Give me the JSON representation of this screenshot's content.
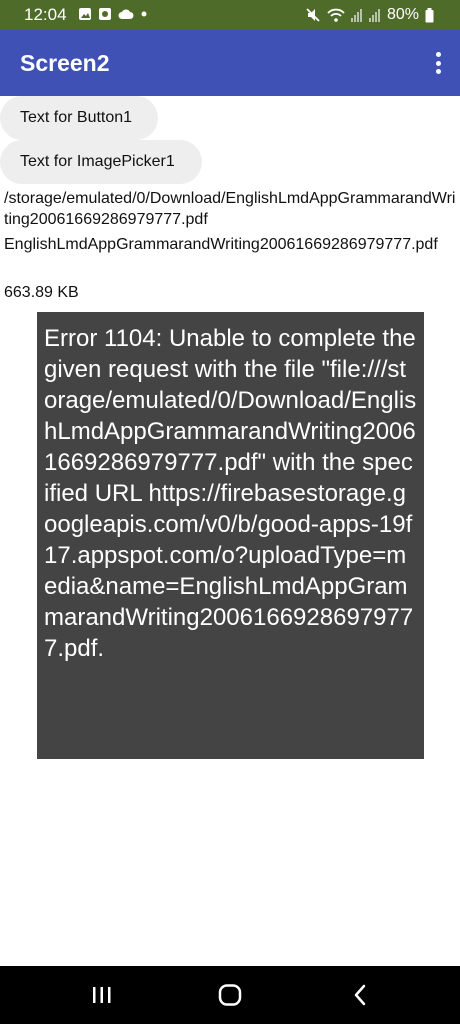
{
  "status_bar": {
    "time": "12:04",
    "left_icons": [
      "image-icon",
      "photo-icon",
      "cloud-icon",
      "dot-icon"
    ],
    "right_icons": [
      "mute-icon",
      "wifi-icon",
      "signal-icon",
      "signal-icon",
      "battery-icon"
    ],
    "battery": "80%"
  },
  "app_bar": {
    "title": "Screen2",
    "background": "#3f51b5",
    "menu_icon": "more-vert-icon"
  },
  "main": {
    "button1_label": "Text for Button1",
    "imagepicker_label": "Text for ImagePicker1",
    "file_path": "/storage/emulated/0/Download/EnglishLmdAppGrammarandWriting20061669286979777.pdf",
    "file_name": "EnglishLmdAppGrammarandWriting20061669286979777.pdf",
    "file_size": "663.89 KB"
  },
  "error": {
    "message": "Error 1104: Unable to complete the given request with the file \"file:///storage/emulated/0/Download/EnglishLmdAppGrammarandWriting20061669286979777.pdf\" with the specified URL https://firebasestorage.googleapis.com/v0/b/good-apps-19f17.appspot.com/o?uploadType=media&name=EnglishLmdAppGrammarandWriting20061669286979777.pdf."
  },
  "nav_bar": {
    "icons": [
      "recents-icon",
      "home-icon",
      "back-icon"
    ]
  }
}
